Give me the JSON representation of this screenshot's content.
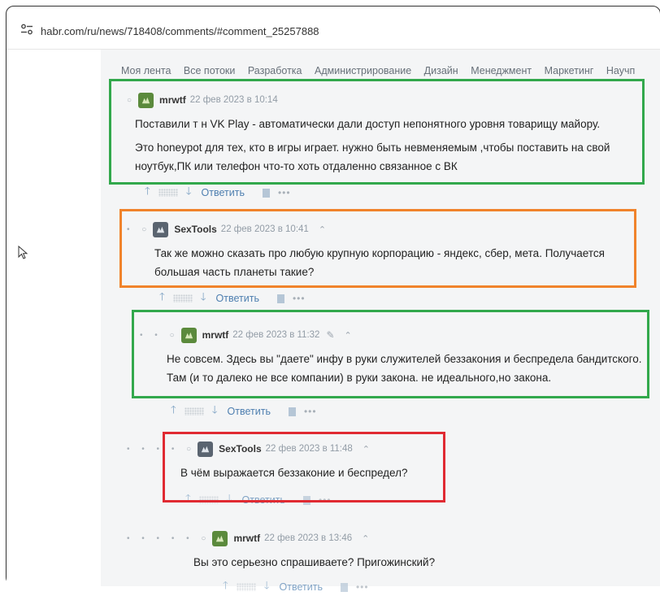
{
  "browser": {
    "url": "habr.com/ru/news/718408/comments/#comment_25257888"
  },
  "nav": {
    "items": [
      "Моя лента",
      "Все потоки",
      "Разработка",
      "Администрирование",
      "Дизайн",
      "Менеджмент",
      "Маркетинг",
      "Научп"
    ]
  },
  "comments": [
    {
      "author": "mrwtf",
      "time": "22 фев 2023 в 10:14",
      "lines": [
        "Поставили т н VK Play - автоматически дали доступ непонятного уровня товарищу майору.",
        "Это honeypot для тех, кто в игры играет. нужно быть невменяемым ,чтобы поставить на свой ноутбук,ПК или телефон что-то хоть отдаленно связанное с ВК"
      ],
      "reply": "Ответить"
    },
    {
      "author": "SexTools",
      "time": "22 фев 2023 в 10:41",
      "lines": [
        "Так же можно сказать про любую крупную корпорацию - яндекс, сбер, мета. Получается большая часть планеты такие?"
      ],
      "reply": "Ответить"
    },
    {
      "author": "mrwtf",
      "time": "22 фев 2023 в 11:32",
      "lines": [
        "Не совсем. Здесь вы \"даете\" инфу в руки служителей беззакония и беспредела бандитского. Там (и то далеко не все компании) в руки закона. не идеального,но закона."
      ],
      "reply": "Ответить"
    },
    {
      "author": "SexTools",
      "time": "22 фев 2023 в 11:48",
      "lines": [
        "В чём выражается беззаконие и беспредел?"
      ],
      "reply": "Ответить"
    },
    {
      "author": "mrwtf",
      "time": "22 фев 2023 в 13:46",
      "lines": [
        "Вы это серьезно спрашиваете? Пригожинский?"
      ],
      "reply": "Ответить"
    }
  ],
  "colors": {
    "green_box": "#32a84c",
    "orange_box": "#f0832b",
    "red_box": "#e02a32",
    "reply_link": "#4e7fb0"
  }
}
